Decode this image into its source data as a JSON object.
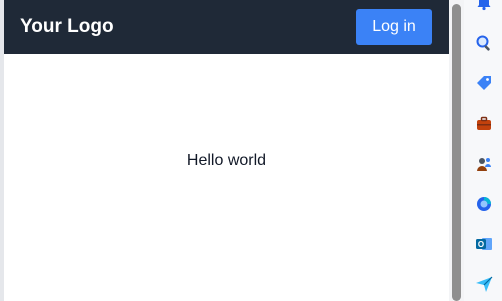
{
  "header": {
    "logo_text": "Your Logo",
    "login_label": "Log in"
  },
  "main": {
    "message": "Hello world"
  },
  "side_panel": {
    "icons": [
      "bell-icon",
      "search-icon",
      "tag-icon",
      "briefcase-icon",
      "people-icon",
      "copilot-icon",
      "outlook-icon",
      "send-icon"
    ]
  },
  "colors": {
    "header_bg": "#1f2937",
    "button_bg": "#3b82f6"
  }
}
